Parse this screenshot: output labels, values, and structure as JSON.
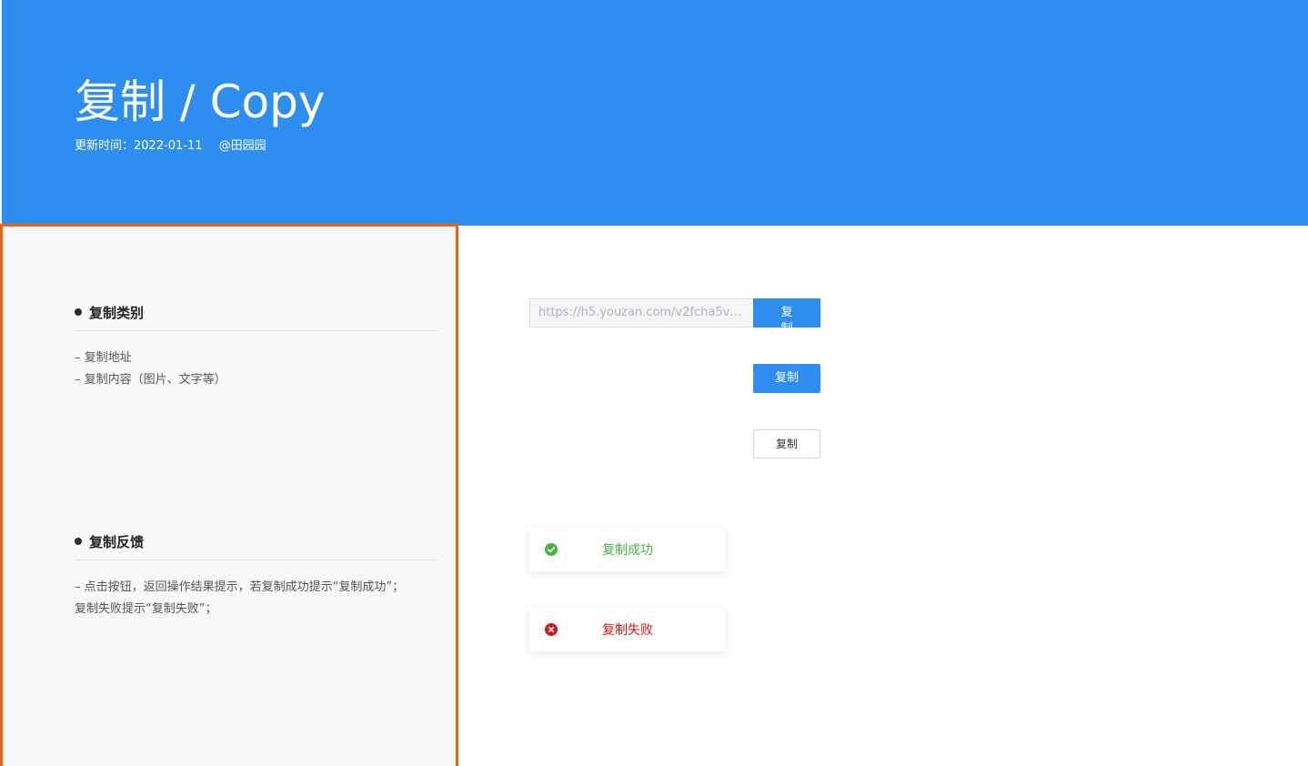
{
  "header": {
    "title": "复制 / Copy",
    "meta_label": "更新时间：",
    "date": "2022-01-11",
    "author": "@田园园"
  },
  "sidebar": {
    "sections": [
      {
        "title": "复制类别",
        "lines": [
          "– 复制地址",
          "– 复制内容（图片、文字等）"
        ]
      },
      {
        "title": "复制反馈",
        "lines": [
          "– 点击按钮，返回操作结果提示，若复制成功提示“复制成功”；",
          "复制失败提示“复制失败”；"
        ]
      }
    ]
  },
  "demo": {
    "url_value": "https://h5.youzan.com/v2fcha5v…",
    "copy_label": "复制",
    "toast_success": "复制成功",
    "toast_fail": "复制失败"
  },
  "colors": {
    "header_bg": "#2e8ef0",
    "highlight_border": "#f06210",
    "success": "#45b33f",
    "fail": "#d41515"
  },
  "icons": {
    "success": "check-circle-icon",
    "fail": "close-circle-icon"
  }
}
